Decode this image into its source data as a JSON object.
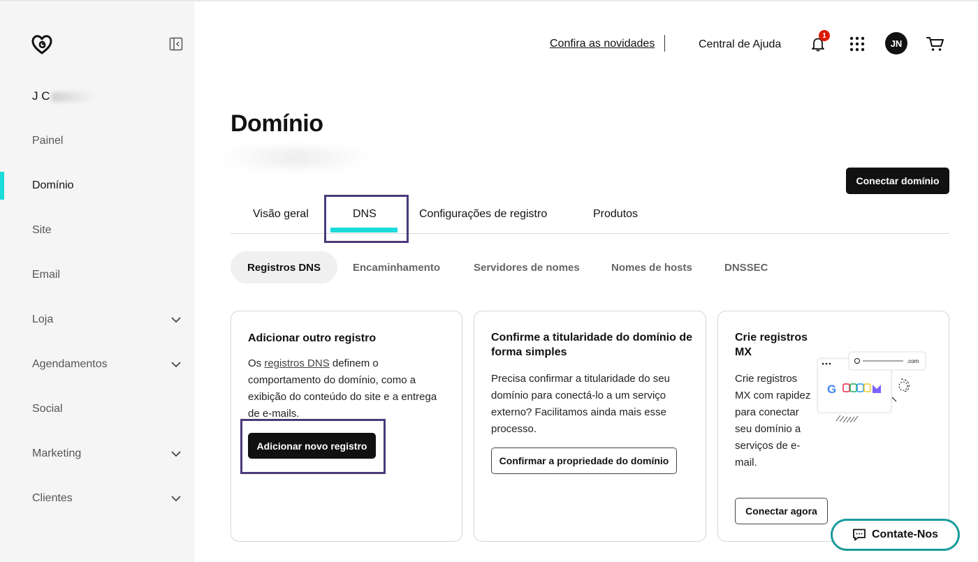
{
  "sidebar": {
    "user_name": "J C",
    "items": [
      {
        "label": "Painel",
        "has_chevron": false
      },
      {
        "label": "Domínio",
        "has_chevron": false,
        "active": true
      },
      {
        "label": "Site",
        "has_chevron": false
      },
      {
        "label": "Email",
        "has_chevron": false
      },
      {
        "label": "Loja",
        "has_chevron": true
      },
      {
        "label": "Agendamentos",
        "has_chevron": true
      },
      {
        "label": "Social",
        "has_chevron": false
      },
      {
        "label": "Marketing",
        "has_chevron": true
      },
      {
        "label": "Clientes",
        "has_chevron": true
      }
    ]
  },
  "header": {
    "news_link": "Confira as novidades",
    "help_link": "Central de Ajuda",
    "notification_count": "1",
    "avatar_initials": "JN"
  },
  "main": {
    "title": "Domínio",
    "connect_button": "Conectar domínio",
    "tabs": [
      {
        "label": "Visão geral"
      },
      {
        "label": "DNS",
        "active": true
      },
      {
        "label": "Configurações de registro"
      },
      {
        "label": "Produtos"
      }
    ],
    "subtabs": [
      {
        "label": "Registros DNS",
        "active": true
      },
      {
        "label": "Encaminhamento"
      },
      {
        "label": "Servidores de nomes"
      },
      {
        "label": "Nomes de hosts"
      },
      {
        "label": "DNSSEC"
      }
    ],
    "cards": {
      "add": {
        "title": "Adicionar outro registro",
        "text_before": "Os ",
        "link": "registros DNS",
        "text_after": " definem o comportamento do domínio, como a exibição do conteúdo do site e a entrega de e-mails.",
        "button": "Adicionar novo registro"
      },
      "ownership": {
        "title": "Confirme a titularidade do domínio de forma simples",
        "text": "Precisa confirmar a titularidade do seu domínio para conectá-lo a um serviço externo? Facilitamos ainda mais esse processo.",
        "button": "Confirmar a propriedade do domínio"
      },
      "mx": {
        "title": "Crie registros MX",
        "text": "Crie registros MX com rapidez para conectar seu domínio a serviços de e-mail.",
        "button": "Conectar agora",
        "illus_tld": ".com"
      }
    },
    "contact_button": "Contate-Nos"
  },
  "colors": {
    "accent": "#1bdbdb",
    "highlight": "#4a3a7a",
    "badge": "#db1802",
    "contact_border": "#1b9b9b"
  }
}
